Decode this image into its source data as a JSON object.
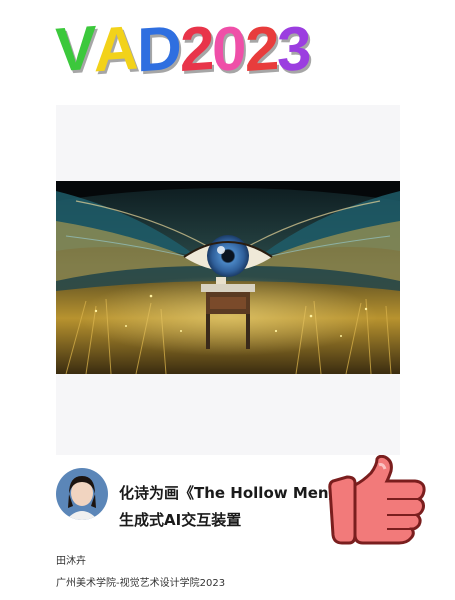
{
  "logo": {
    "letters": [
      {
        "char": "V",
        "color": "#3cc83c"
      },
      {
        "char": "A",
        "color": "#f2d21a"
      },
      {
        "char": "D",
        "color": "#2f6fe0"
      },
      {
        "char": "2",
        "color": "#e8354a"
      },
      {
        "char": "0",
        "color": "#ef4fa8"
      },
      {
        "char": "2",
        "color": "#e83c3c"
      },
      {
        "char": "3",
        "color": "#9b3ee0"
      }
    ]
  },
  "project": {
    "title": "化诗为画《The Hollow Men》",
    "subtitle": "生成式AI交互装置"
  },
  "author": {
    "name": "田沐卉",
    "school": "广州美术学院-视觉艺术设计学院2023"
  },
  "icons": {
    "like": "thumbs-up-icon",
    "avatar": "person-avatar"
  },
  "colors": {
    "panel_bg": "#f6f6f8",
    "like_fill": "#f27a7a",
    "like_outline": "#7a1e1e"
  }
}
